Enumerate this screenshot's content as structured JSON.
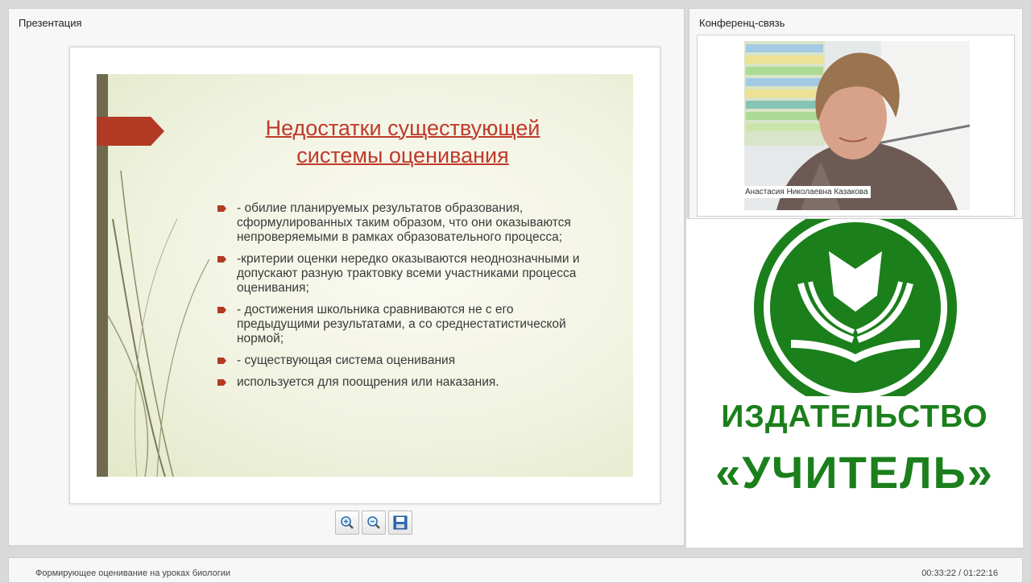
{
  "presentation_panel": {
    "title": "Презентация"
  },
  "slide": {
    "title_line1": "Недостатки существующей",
    "title_line2": "системы оценивания",
    "bullets": [
      "- обилие планируемых результатов образования, сформулированных таким образом, что они оказываются непроверяемыми в рамках образовательного процесса;",
      "-критерии оценки нередко оказываются неоднозначными и  допускают разную трактовку всеми участниками процесса оценивания;",
      "- достижения школьника сравниваются не с его предыдущими результатами, а со среднестатистической нормой;",
      "- существующая система оценивания",
      "используется для поощрения или наказания."
    ]
  },
  "toolbar": {
    "zoom_in_icon": "zoom-in-icon",
    "zoom_out_icon": "zoom-out-icon",
    "save_icon": "save-icon"
  },
  "conference_panel": {
    "title": "Конференц-связь",
    "participant_name": "Анастасия Николаевна Казакова"
  },
  "logo": {
    "line1": "ИЗДАТЕЛЬСТВО",
    "line2": "«УЧИТЕЛЬ»",
    "color": "#1b7f1b"
  },
  "footer": {
    "title": "Формирующее оценивание на уроках биологии",
    "time": "00:33:22 / 01:22:16"
  },
  "colors": {
    "accent_red": "#b23a24",
    "title_red": "#c0392b"
  }
}
